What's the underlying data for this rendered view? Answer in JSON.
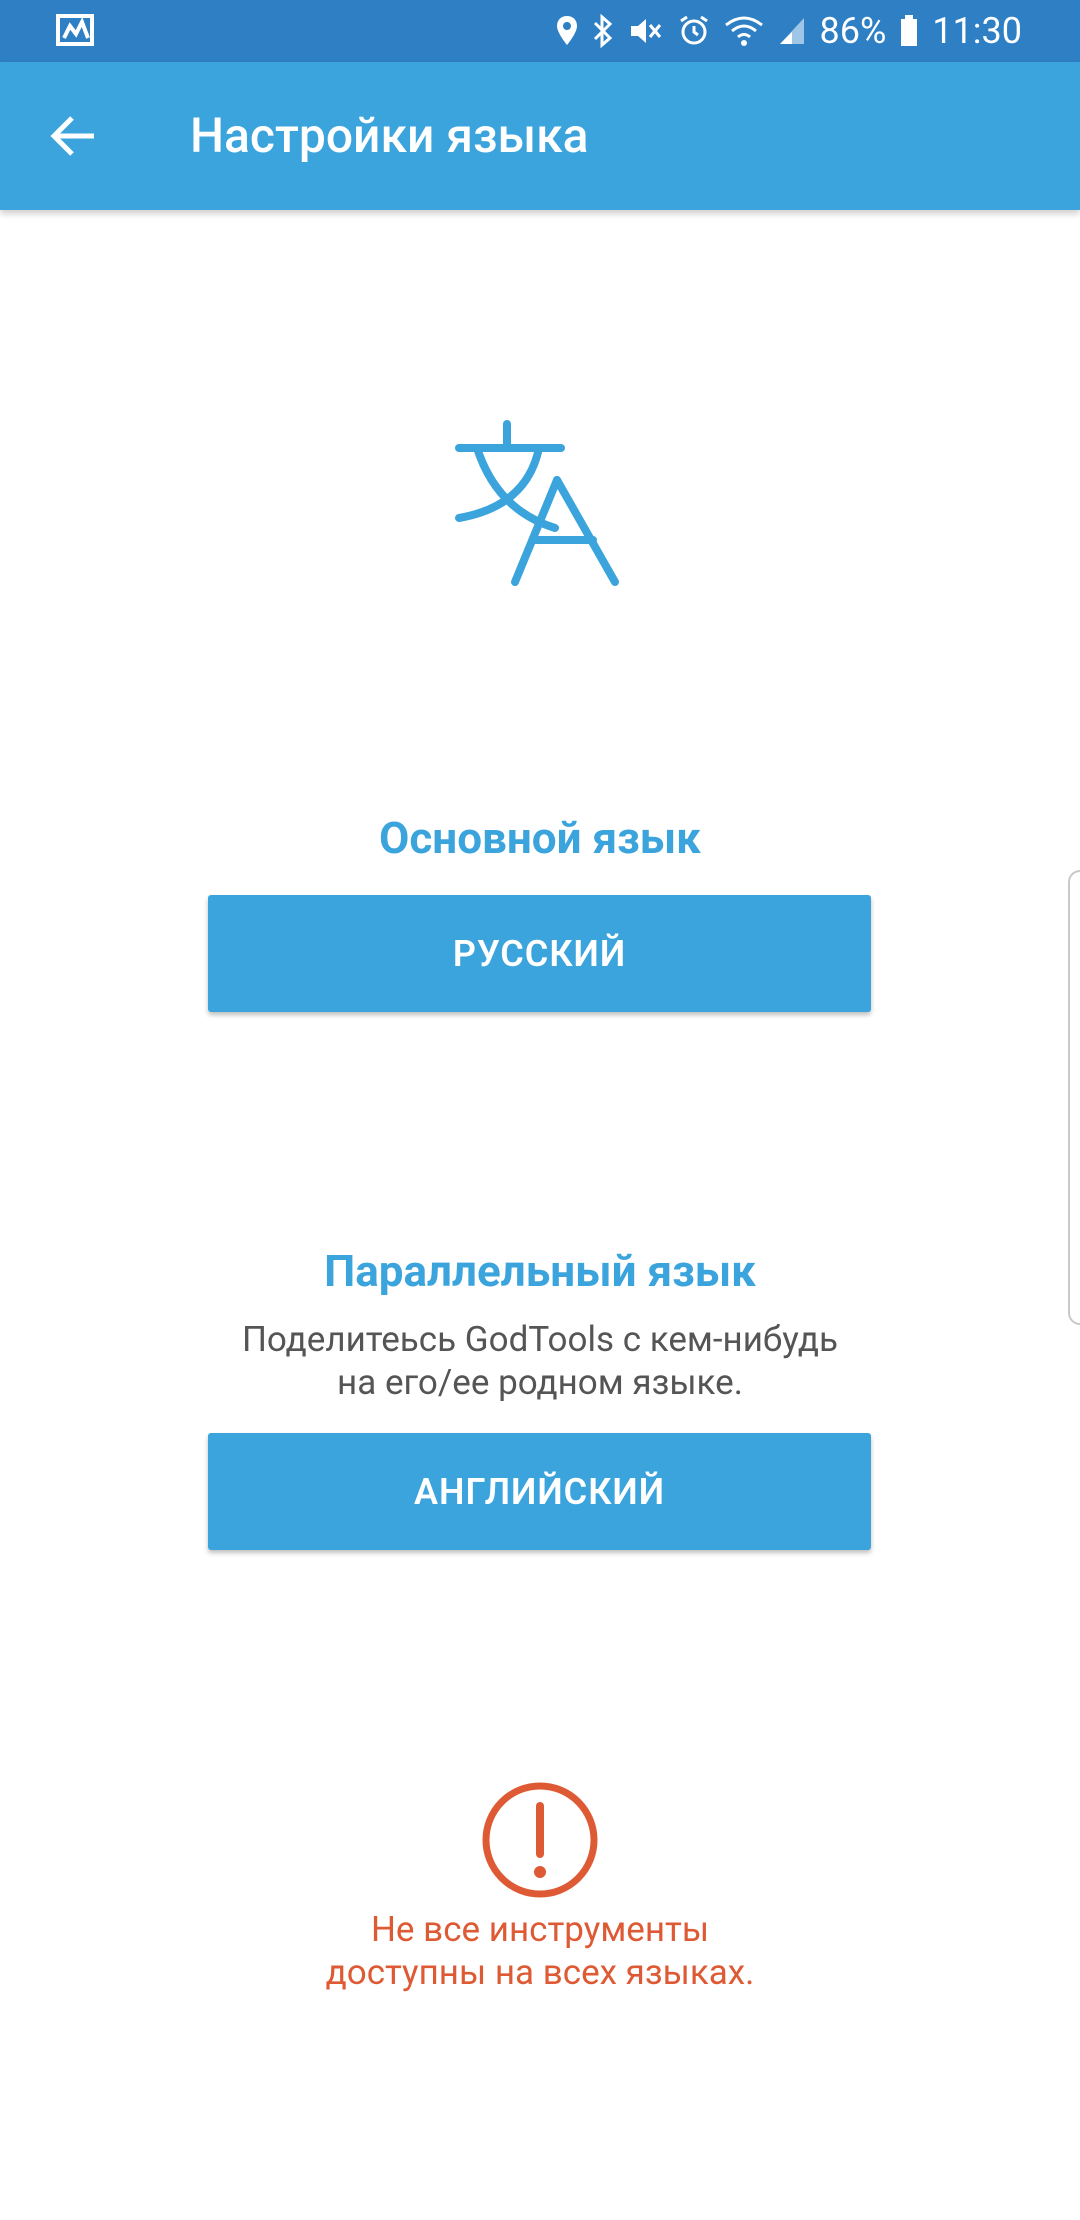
{
  "status_bar": {
    "battery": "86%",
    "time": "11:30",
    "icons": [
      "gallery-icon",
      "location-icon",
      "bluetooth-icon",
      "mute-icon",
      "alarm-icon",
      "wifi-icon",
      "signal-icon",
      "battery-icon"
    ]
  },
  "app_bar": {
    "title": "Настройки языка",
    "back_icon": "arrow-left-icon"
  },
  "primary": {
    "title": "Основной язык",
    "button_label": "РУССКИЙ"
  },
  "parallel": {
    "title": "Параллельный язык",
    "description_line1": "Поделитеьсь GodTools с кем-нибудь",
    "description_line2": "на его/ее родном языке.",
    "button_label": "АНГЛИЙСКИЙ"
  },
  "warning": {
    "line1": "Не все инструменты",
    "line2": "доступны на всех языках."
  },
  "colors": {
    "status_bar": "#2f7fc4",
    "accent": "#3ba4dc",
    "warning": "#de5a34"
  }
}
